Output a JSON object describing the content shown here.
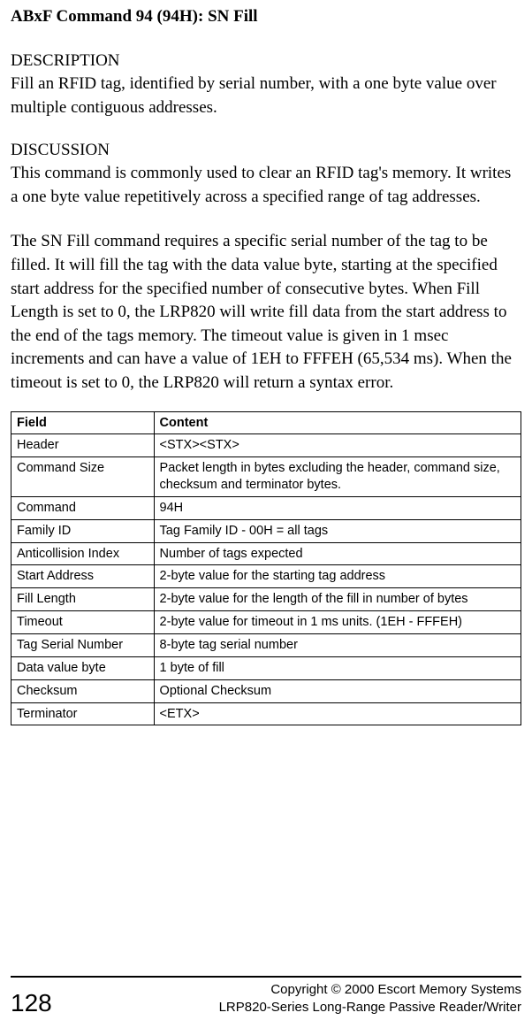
{
  "title": "ABxF Command 94 (94H): SN Fill",
  "description": {
    "heading": "DESCRIPTION",
    "text": "Fill an RFID tag, identified by serial number, with a one byte value over multiple contiguous addresses."
  },
  "discussion": {
    "heading": "DISCUSSION",
    "p1": "This command is commonly used to clear an RFID tag's memory. It writes a one byte value repetitively across a specified range of tag addresses.",
    "p2": "The SN Fill command requires a specific serial number of the tag to be filled. It will fill the tag with the data value byte, starting at the specified start address for the specified number of consecutive bytes. When Fill Length is set to 0, the LRP820 will write fill data from the start address to the end of the tags memory. The timeout value is given in 1 msec increments and can have a value of 1EH to FFFEH (65,534 ms). When the timeout is set to 0, the LRP820 will return a syntax error."
  },
  "table": {
    "headers": {
      "field": "Field",
      "content": "Content"
    },
    "rows": [
      {
        "field": "Header",
        "content": "<STX><STX>"
      },
      {
        "field": "Command Size",
        "content": "Packet length in bytes excluding the header, command size, checksum and terminator bytes."
      },
      {
        "field": "Command",
        "content": "94H"
      },
      {
        "field": "Family ID",
        "content": "Tag Family ID - 00H = all tags"
      },
      {
        "field": "Anticollision Index",
        "content": "Number of tags expected"
      },
      {
        "field": "Start Address",
        "content": "2-byte value for the starting tag address"
      },
      {
        "field": "Fill Length",
        "content": "2-byte value for the length of the fill in number of bytes"
      },
      {
        "field": "Timeout",
        "content": "2-byte value for timeout in 1 ms units. (1EH - FFFEH)"
      },
      {
        "field": "Tag Serial Number",
        "content": "8-byte tag serial number"
      },
      {
        "field": "Data value byte",
        "content": "1 byte of fill"
      },
      {
        "field": "Checksum",
        "content": "Optional Checksum"
      },
      {
        "field": "Terminator",
        "content": "<ETX>"
      }
    ]
  },
  "footer": {
    "page": "128",
    "line1": "Copyright © 2000 Escort Memory Systems",
    "line2": "LRP820-Series Long-Range Passive Reader/Writer"
  }
}
